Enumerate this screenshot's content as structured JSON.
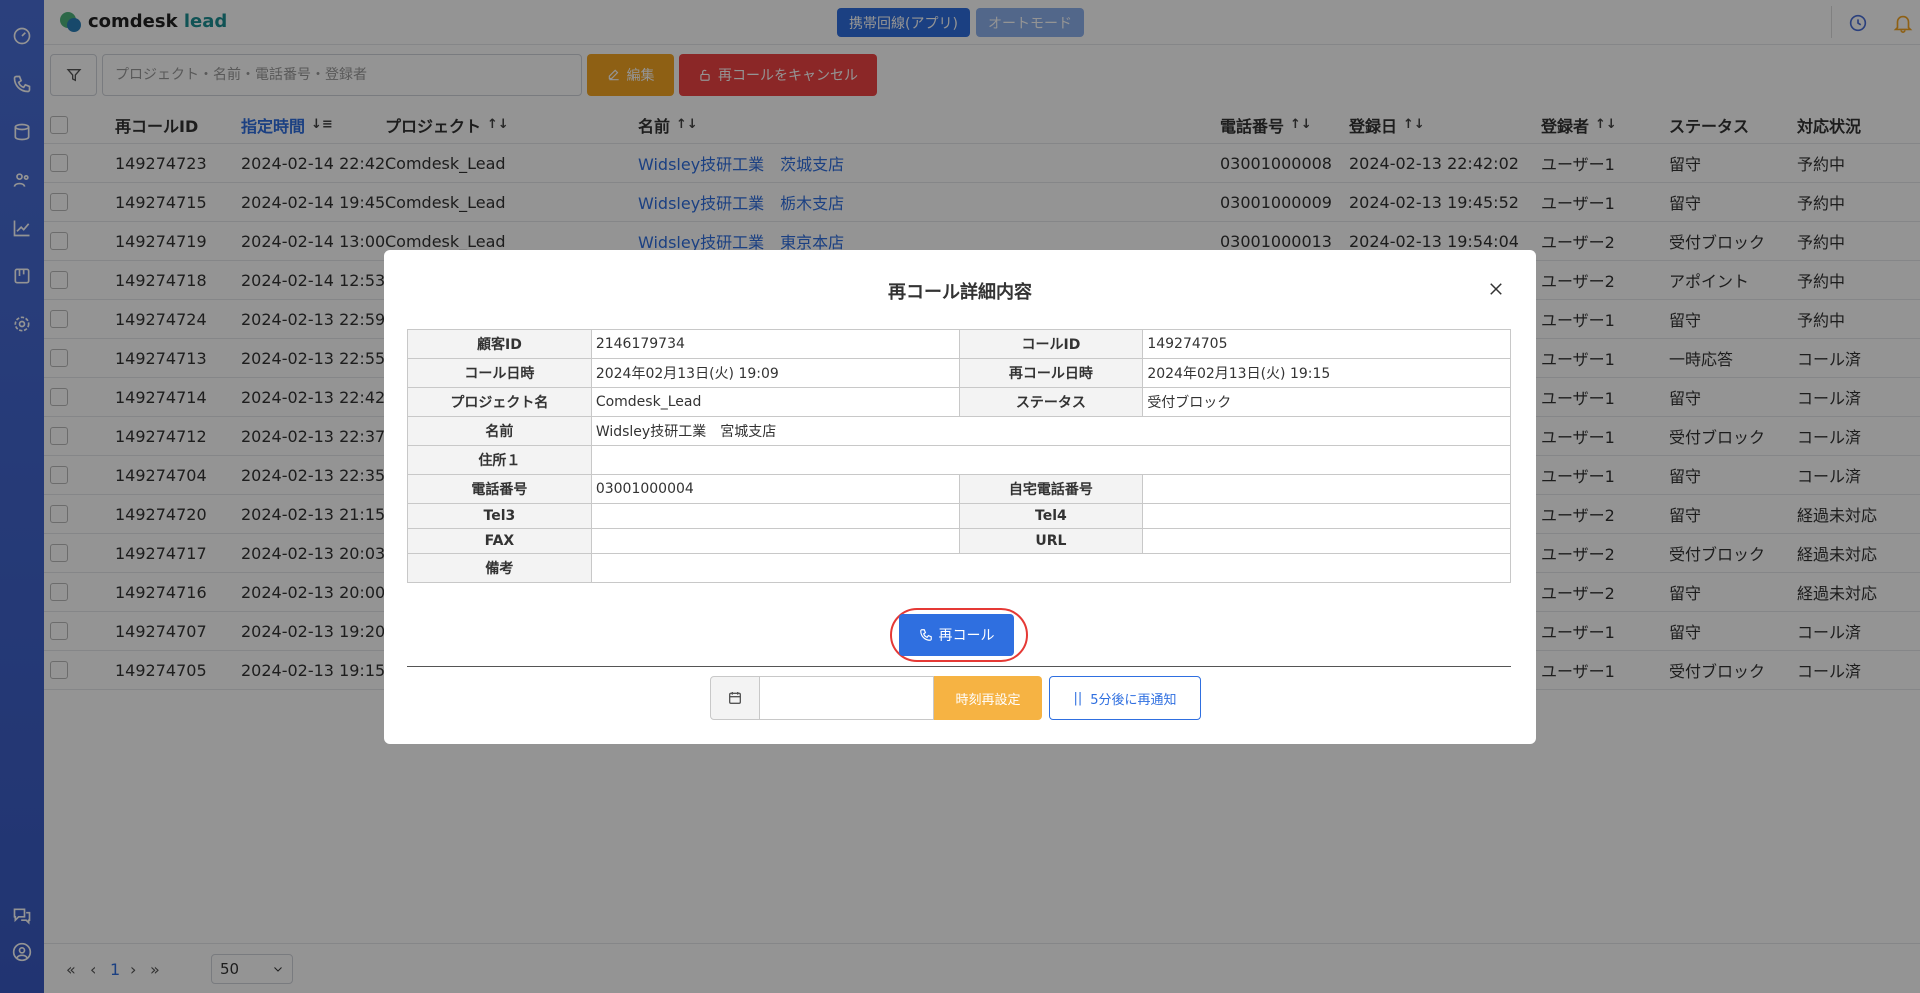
{
  "app": {
    "logo_main": "comdesk",
    "logo_sub": "lead"
  },
  "mode_buttons": {
    "mobile": "携帯回線(アプリ)",
    "auto": "オートモード"
  },
  "toolbar": {
    "search_placeholder": "プロジェクト・名前・電話番号・登録者",
    "edit_label": "編集",
    "cancel_recall_label": "再コールをキャンセル"
  },
  "table": {
    "headers": {
      "recall_id": "再コールID",
      "scheduled": "指定時間",
      "project": "プロジェクト",
      "name": "名前",
      "phone": "電話番号",
      "registered": "登録日",
      "registrant": "登録者",
      "status": "ステータス",
      "handling": "対応状況"
    },
    "sort_icon": "↑↓",
    "rows": [
      {
        "id": "149274723",
        "time": "2024-02-14 22:42",
        "project": "Comdesk_Lead",
        "name": "Widsley技研工業　茨城支店",
        "phone": "03001000008",
        "registered": "2024-02-13 22:42:02",
        "user": "ユーザー1",
        "status": "留守",
        "handling": "予約中"
      },
      {
        "id": "149274715",
        "time": "2024-02-14 19:45",
        "project": "Comdesk_Lead",
        "name": "Widsley技研工業　栃木支店",
        "phone": "03001000009",
        "registered": "2024-02-13 19:45:52",
        "user": "ユーザー1",
        "status": "留守",
        "handling": "予約中"
      },
      {
        "id": "149274719",
        "time": "2024-02-14 13:00",
        "project": "Comdesk_Lead",
        "name": "Widsley技研工業　東京本店",
        "phone": "03001000013",
        "registered": "2024-02-13 19:54:04",
        "user": "ユーザー2",
        "status": "受付ブロック",
        "handling": "予約中"
      },
      {
        "id": "149274718",
        "time": "2024-02-14 12:53",
        "project": "",
        "name": "",
        "phone": "",
        "registered": "",
        "user": "ユーザー2",
        "status": "アポイント",
        "handling": "予約中"
      },
      {
        "id": "149274724",
        "time": "2024-02-13 22:59",
        "project": "",
        "name": "",
        "phone": "",
        "registered": "",
        "user": "ユーザー1",
        "status": "留守",
        "handling": "予約中"
      },
      {
        "id": "149274713",
        "time": "2024-02-13 22:55",
        "project": "",
        "name": "",
        "phone": "",
        "registered": "",
        "user": "ユーザー1",
        "status": "一時応答",
        "handling": "コール済"
      },
      {
        "id": "149274714",
        "time": "2024-02-13 22:42",
        "project": "",
        "name": "",
        "phone": "",
        "registered": "",
        "user": "ユーザー1",
        "status": "留守",
        "handling": "コール済"
      },
      {
        "id": "149274712",
        "time": "2024-02-13 22:37",
        "project": "",
        "name": "",
        "phone": "",
        "registered": "",
        "user": "ユーザー1",
        "status": "受付ブロック",
        "handling": "コール済"
      },
      {
        "id": "149274704",
        "time": "2024-02-13 22:35",
        "project": "",
        "name": "",
        "phone": "",
        "registered": "",
        "user": "ユーザー1",
        "status": "留守",
        "handling": "コール済"
      },
      {
        "id": "149274720",
        "time": "2024-02-13 21:15",
        "project": "",
        "name": "",
        "phone": "",
        "registered": "",
        "user": "ユーザー2",
        "status": "留守",
        "handling": "経過未対応"
      },
      {
        "id": "149274717",
        "time": "2024-02-13 20:03",
        "project": "",
        "name": "",
        "phone": "",
        "registered": "",
        "user": "ユーザー2",
        "status": "受付ブロック",
        "handling": "経過未対応"
      },
      {
        "id": "149274716",
        "time": "2024-02-13 20:00",
        "project": "",
        "name": "",
        "phone": "",
        "registered": "",
        "user": "ユーザー2",
        "status": "留守",
        "handling": "経過未対応"
      },
      {
        "id": "149274707",
        "time": "2024-02-13 19:20",
        "project": "",
        "name": "",
        "phone": "",
        "registered": "",
        "user": "ユーザー1",
        "status": "留守",
        "handling": "コール済"
      },
      {
        "id": "149274705",
        "time": "2024-02-13 19:15",
        "project": "",
        "name": "",
        "phone": "",
        "registered": "",
        "user": "ユーザー1",
        "status": "受付ブロック",
        "handling": "コール済"
      }
    ]
  },
  "pagination": {
    "first": "«",
    "prev": "‹",
    "current": "1",
    "next": "›",
    "last": "»",
    "per_page": "50"
  },
  "modal": {
    "title": "再コール詳細内容",
    "fields": {
      "customer_id_label": "顧客ID",
      "customer_id": "2146179734",
      "call_id_label": "コールID",
      "call_id": "149274705",
      "call_datetime_label": "コール日時",
      "call_datetime": "2024年02月13日(火) 19:09",
      "recall_datetime_label": "再コール日時",
      "recall_datetime": "2024年02月13日(火) 19:15",
      "project_label": "プロジェクト名",
      "project": "Comdesk_Lead",
      "status_label": "ステータス",
      "status": "受付ブロック",
      "name_label": "名前",
      "name": "Widsley技研工業　宮城支店",
      "address_label": "住所１",
      "address": "",
      "phone_label": "電話番号",
      "phone": "03001000004",
      "home_phone_label": "自宅電話番号",
      "home_phone": "",
      "tel3_label": "Tel3",
      "tel3": "",
      "tel4_label": "Tel4",
      "tel4": "",
      "fax_label": "FAX",
      "fax": "",
      "url_label": "URL",
      "url": "",
      "note_label": "備考",
      "note": ""
    },
    "recall_button": "再コール",
    "reset_time_button": "時刻再設定",
    "snooze_button": "5分後に再通知"
  }
}
